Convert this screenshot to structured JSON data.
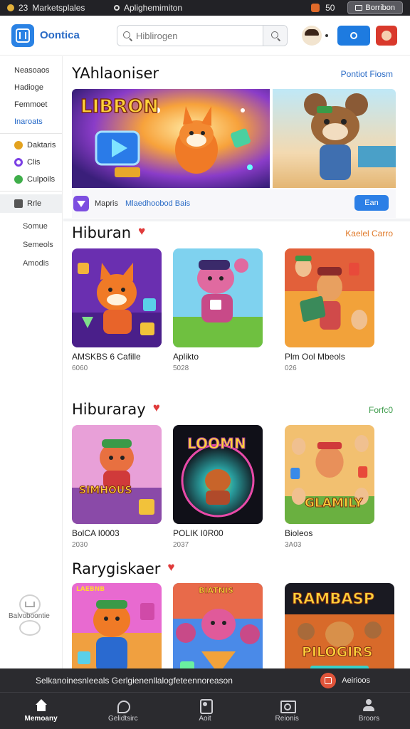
{
  "status_bar": {
    "time": "23",
    "app_name": "Marketsplales",
    "url": "Aplighemimiton",
    "battery": "50",
    "button_label": "Borribon"
  },
  "header": {
    "brand": "Oontica",
    "search_placeholder": "Hiblirogen"
  },
  "sidebar": {
    "items": [
      {
        "label": "Neasoaos"
      },
      {
        "label": "Hadioge"
      },
      {
        "label": "Femmoet"
      },
      {
        "label": "Inaroats"
      }
    ],
    "icon_items": [
      {
        "label": "Daktaris",
        "icon": "gear-icon",
        "color": "#e3a21f"
      },
      {
        "label": "Clis",
        "icon": "circle-icon",
        "color": "#7b3fe4"
      },
      {
        "label": "Culpoils",
        "icon": "puzzle-icon",
        "color": "#3fae4a"
      }
    ],
    "group_label": "Rrle",
    "plain_items": [
      {
        "label": "Somue"
      },
      {
        "label": "Semeols"
      },
      {
        "label": "Amodis"
      }
    ],
    "widget_label": "Balvoboontie"
  },
  "featured": {
    "title": "YAhlaoniser",
    "link": "Pontiot  Fiosm",
    "banner_text": "LIBRON",
    "bar_label": "Mapris",
    "bar_sublabel": "Mlaedhoobod Bais",
    "bar_button": "Ean"
  },
  "sections": [
    {
      "title": "Hiburan",
      "link": "Kaelel  Carro",
      "link_color": "#e07a2a",
      "cards": [
        {
          "name": "AMSKBS 6 Cafille",
          "meta": "6060"
        },
        {
          "name": "Aplikto",
          "meta": "5028"
        },
        {
          "name": "Plm Ool Mbeols",
          "meta": "026"
        }
      ]
    },
    {
      "title": "Hiburaray",
      "link": "Forfc0",
      "link_color": "#3a9a48",
      "cards": [
        {
          "name": "BolCA I0003",
          "meta": "2030",
          "art_text": "SIMHOUS"
        },
        {
          "name": "POLIK I0R00",
          "meta": "2037",
          "art_text": "LOOMN"
        },
        {
          "name": "Bioleos",
          "meta": "3A03",
          "art_text": "GLAMILY"
        }
      ]
    },
    {
      "title": "Rarygiskaer",
      "cards": [
        {
          "art_text": "LAEBNB"
        },
        {
          "art_text": "BIATNIS"
        },
        {
          "art_text": "RAMBASP",
          "art_text_2": "PILOGIRS"
        }
      ]
    }
  ],
  "bottom_bar": {
    "notice": "Selkanoinesnleeals Gerlgienenllalogfeteennoreason",
    "action_label": "Aeirioos",
    "tabs": [
      {
        "label": "Memoany",
        "icon": "home-icon"
      },
      {
        "label": "Gelidtsirc",
        "icon": "game-icon"
      },
      {
        "label": "Aoit",
        "icon": "user-icon"
      },
      {
        "label": "Reionis",
        "icon": "photo-icon"
      },
      {
        "label": "Broors",
        "icon": "profile-icon"
      }
    ]
  }
}
